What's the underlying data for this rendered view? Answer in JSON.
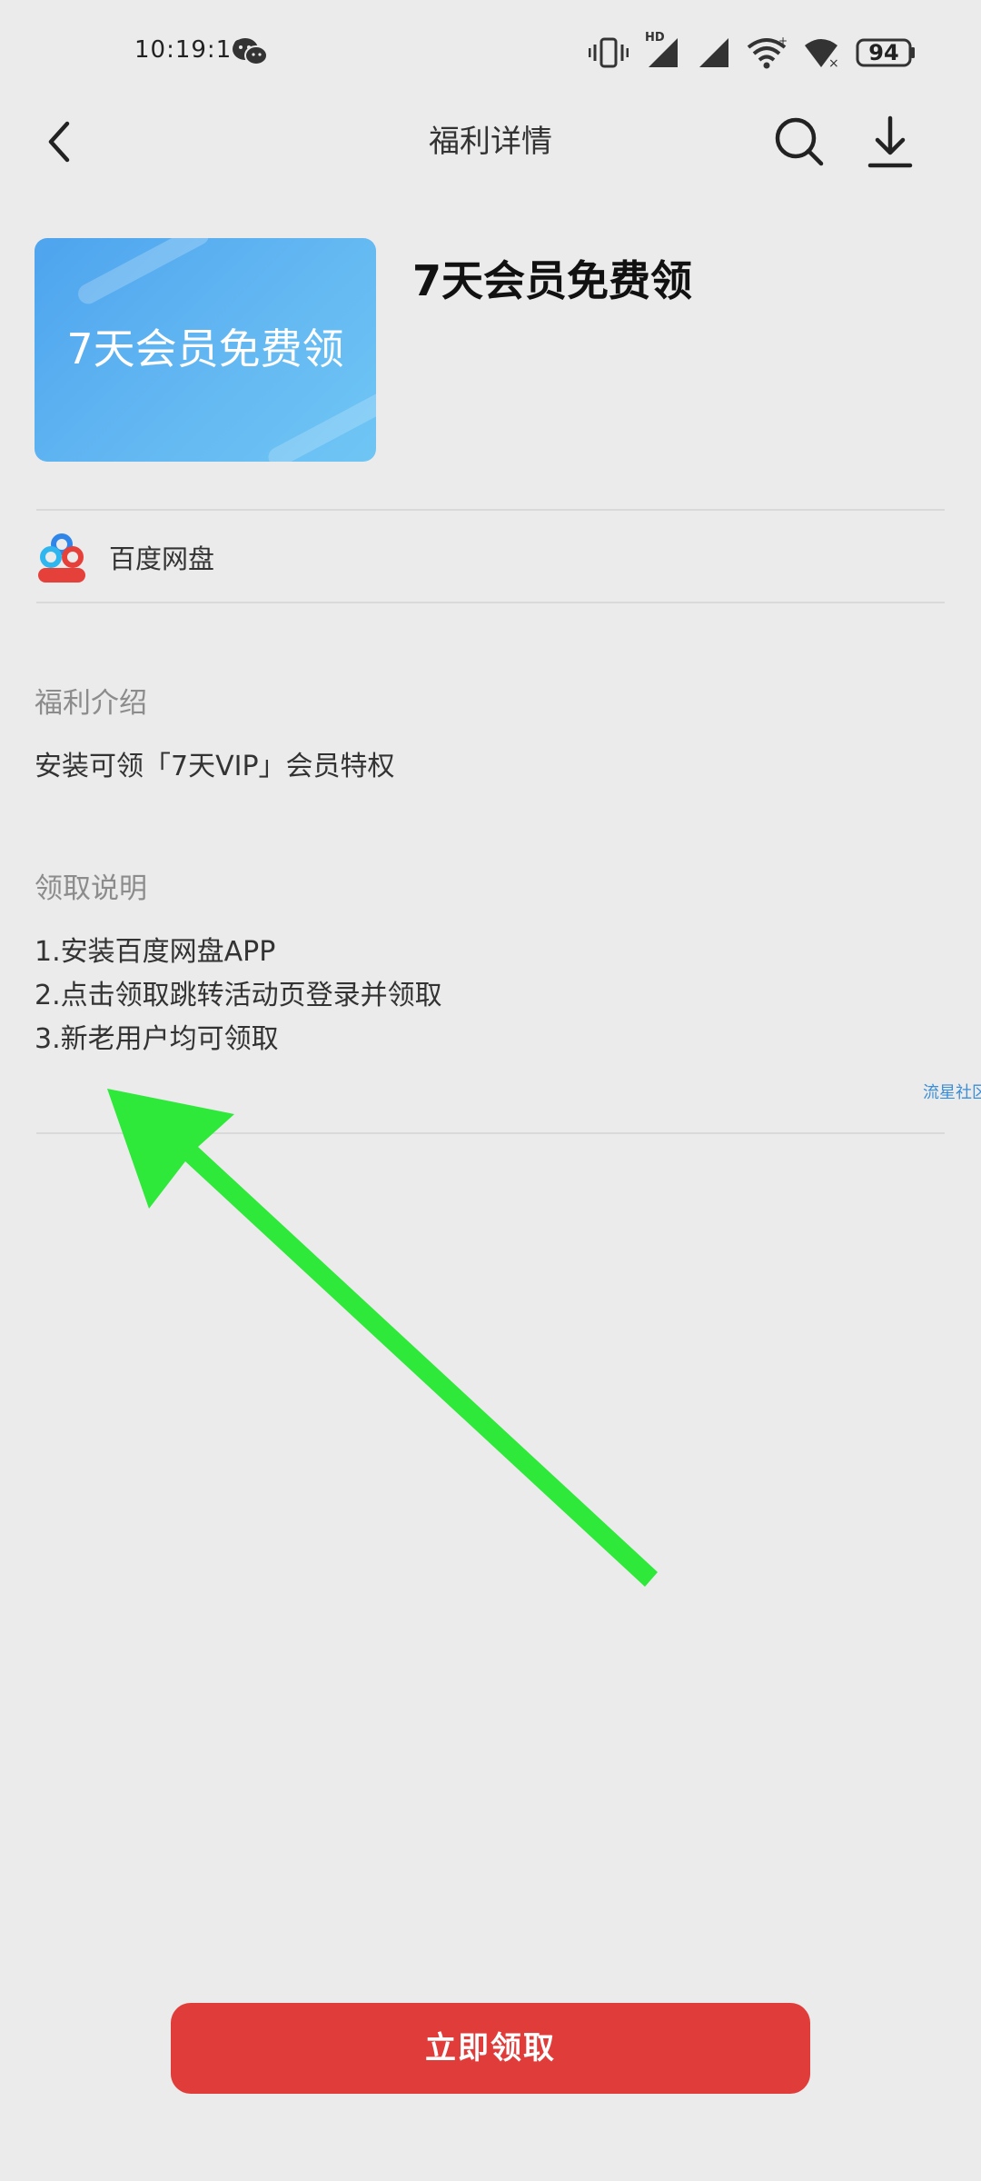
{
  "status_bar": {
    "time": "10:19:10",
    "battery": "94",
    "network_badge": "HD",
    "icons": [
      "wechat-icon",
      "vibrate-icon",
      "signal-icon",
      "wifi-icon",
      "battery-icon"
    ]
  },
  "header": {
    "title": "福利详情",
    "icons": [
      "back-icon",
      "search-icon",
      "download-icon"
    ]
  },
  "product": {
    "banner_text": "7天会员免费领",
    "title": "7天会员免费领",
    "banner_color": "#5aaef0"
  },
  "app": {
    "name": "百度网盘",
    "logo_text": "百度网盘"
  },
  "intro": {
    "heading": "福利介绍",
    "text": "安装可领「7天VIP」会员特权"
  },
  "instructions": {
    "heading": "领取说明",
    "steps": [
      "1.安装百度网盘APP",
      "2.点击领取跳转活动页登录并领取",
      "3.新老用户均可领取"
    ]
  },
  "watermark": "流星社区",
  "claim_button": {
    "label": "立即领取",
    "color": "#e03c3a"
  },
  "annotation": {
    "color": "#2ee83a"
  }
}
